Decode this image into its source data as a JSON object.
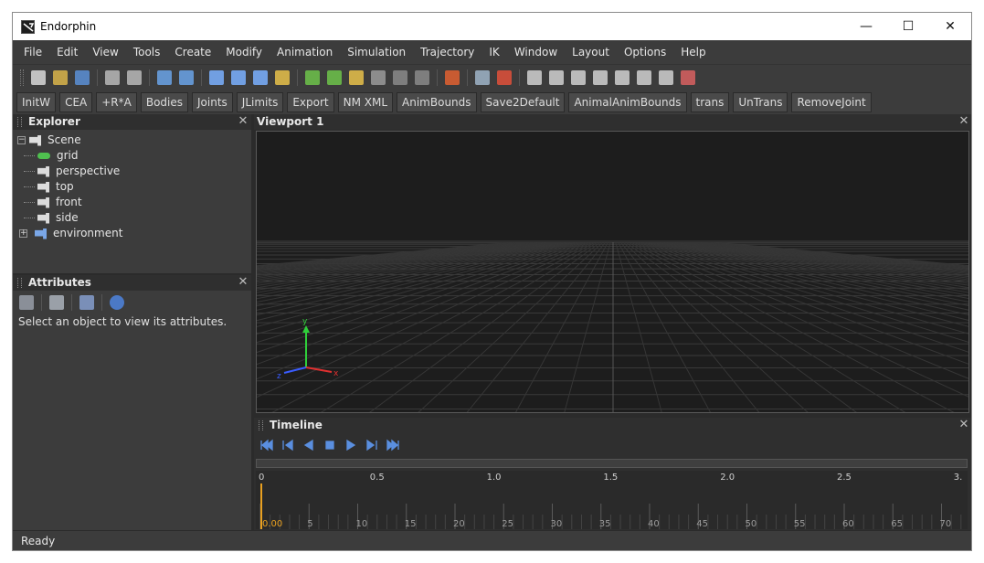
{
  "window": {
    "title": "Endorphin",
    "controls": {
      "minimize": "—",
      "maximize": "☐",
      "close": "✕"
    }
  },
  "menubar": [
    "File",
    "Edit",
    "View",
    "Tools",
    "Create",
    "Modify",
    "Animation",
    "Simulation",
    "Trajectory",
    "IK",
    "Window",
    "Layout",
    "Options",
    "Help"
  ],
  "toolbar_icons": [
    {
      "name": "new-file-icon",
      "color": "#d8d8d8"
    },
    {
      "name": "open-folder-icon",
      "color": "#d9b44a"
    },
    {
      "name": "save-icon",
      "color": "#5b8fd6"
    },
    {
      "name": "sep"
    },
    {
      "name": "cut-icon",
      "color": "#b9b9b9"
    },
    {
      "name": "paste-icon",
      "color": "#b9b9b9"
    },
    {
      "name": "sep"
    },
    {
      "name": "undo-icon",
      "color": "#6aa3e8"
    },
    {
      "name": "redo-icon",
      "color": "#6aa3e8"
    },
    {
      "name": "sep"
    },
    {
      "name": "select-joint-icon",
      "color": "#7ab0ff"
    },
    {
      "name": "rotate-icon",
      "color": "#7ab0ff"
    },
    {
      "name": "translate-icon",
      "color": "#7ab0ff"
    },
    {
      "name": "scale-icon",
      "color": "#e8c14a"
    },
    {
      "name": "sep"
    },
    {
      "name": "leg-icon",
      "color": "#6dc34a"
    },
    {
      "name": "arm-icon",
      "color": "#6dc34a"
    },
    {
      "name": "foot-icon",
      "color": "#e8c14a"
    },
    {
      "name": "box-icon",
      "color": "#9a9a9a"
    },
    {
      "name": "capsule-icon",
      "color": "#8a8a8a"
    },
    {
      "name": "sphere-icon",
      "color": "#8a8a8a"
    },
    {
      "name": "sep"
    },
    {
      "name": "curve-icon",
      "color": "#e06030"
    },
    {
      "name": "sep"
    },
    {
      "name": "character-icon",
      "color": "#9fb4c8"
    },
    {
      "name": "ragdoll-icon",
      "color": "#e0503a"
    },
    {
      "name": "sep"
    },
    {
      "name": "clapper-icon",
      "color": "#d0d0d0"
    },
    {
      "name": "film-icon",
      "color": "#d0d0d0"
    },
    {
      "name": "window-icon",
      "color": "#d0d0d0"
    },
    {
      "name": "panel-icon",
      "color": "#d0d0d0"
    },
    {
      "name": "capture-icon",
      "color": "#d0d0d0"
    },
    {
      "name": "capture2-icon",
      "color": "#d0d0d0"
    },
    {
      "name": "strip-icon",
      "color": "#d0d0d0"
    },
    {
      "name": "record-icon",
      "color": "#d86060"
    }
  ],
  "button_bar": [
    "InitW",
    "CEA",
    "+R*A",
    "Bodies",
    "Joints",
    "JLimits",
    "Export",
    "NM XML",
    "AnimBounds",
    "Save2Default",
    "AnimalAnimBounds",
    "trans",
    "UnTrans",
    "RemoveJoint"
  ],
  "explorer": {
    "title": "Explorer",
    "close": "✕",
    "tree": [
      {
        "label": "Scene",
        "icon": "scene-icon",
        "toggle": "−",
        "depth": 0
      },
      {
        "label": "grid",
        "icon": "grid-icon",
        "depth": 1
      },
      {
        "label": "perspective",
        "icon": "camera-icon",
        "depth": 1
      },
      {
        "label": "top",
        "icon": "camera-icon",
        "depth": 1
      },
      {
        "label": "front",
        "icon": "camera-icon",
        "depth": 1
      },
      {
        "label": "side",
        "icon": "camera-icon",
        "depth": 1
      },
      {
        "label": "environment",
        "icon": "environment-icon",
        "toggle": "+",
        "depth": 1
      }
    ]
  },
  "attributes": {
    "title": "Attributes",
    "close": "✕",
    "hint": "Select an object to view its attributes."
  },
  "viewport": {
    "title": "Viewport 1",
    "close": "✕",
    "axes": {
      "x": "x",
      "y": "y",
      "z": "z",
      "x_color": "#e03030",
      "y_color": "#2fcf3a",
      "z_color": "#3a5cff"
    }
  },
  "timeline": {
    "title": "Timeline",
    "close": "✕",
    "transport": [
      "go-to-start",
      "step-back",
      "play-backward",
      "stop",
      "play-forward",
      "step-forward",
      "go-to-end"
    ],
    "time_labels": [
      "0",
      "0.5",
      "1.0",
      "1.5",
      "2.0",
      "2.5",
      "3."
    ],
    "frame_labels": [
      "0.00",
      "5",
      "10",
      "15",
      "20",
      "25",
      "30",
      "35",
      "40",
      "45",
      "50",
      "55",
      "60",
      "65",
      "70"
    ],
    "cursor_color": "#e8a020"
  },
  "status": {
    "text": "Ready"
  }
}
